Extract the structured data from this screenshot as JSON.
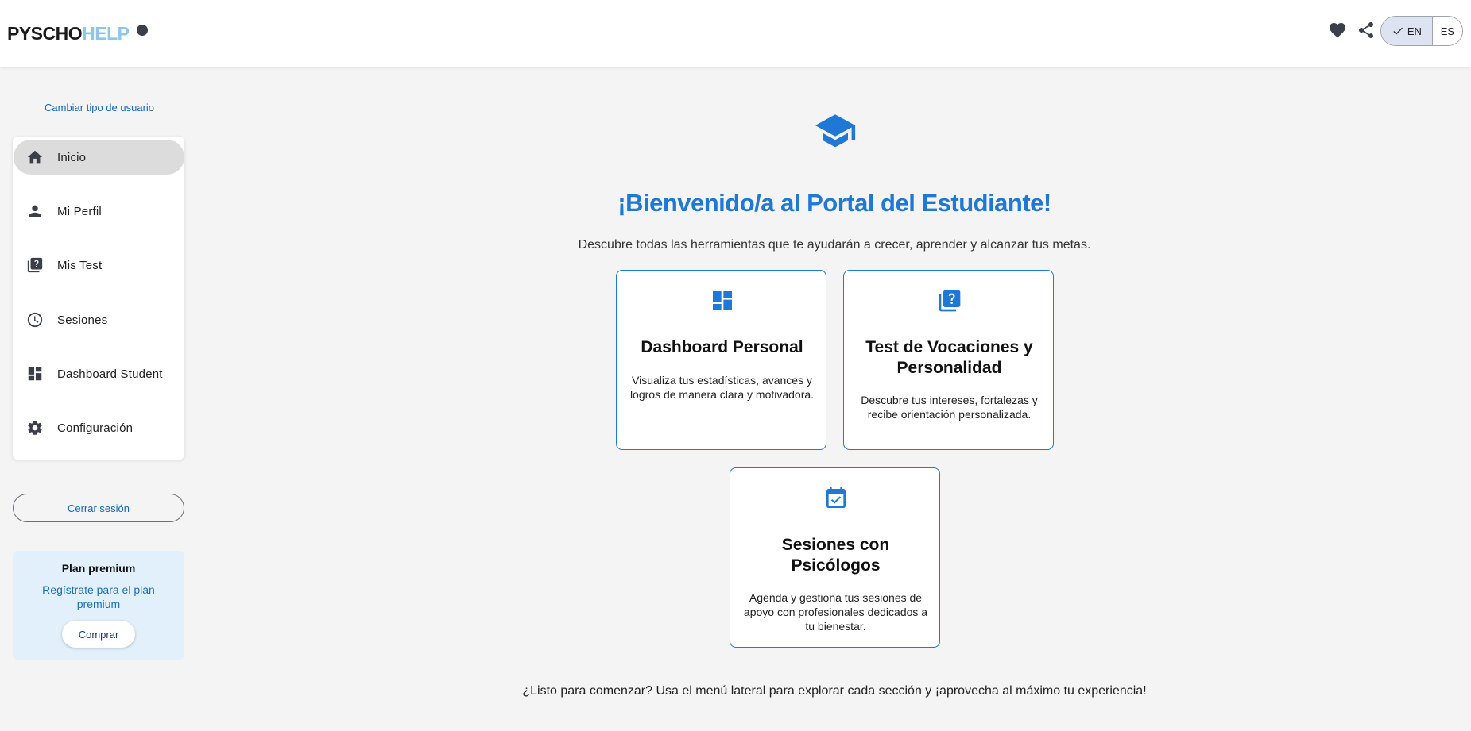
{
  "header": {
    "logo_part1": "PYSCHO",
    "logo_part2": "HELP",
    "lang_en": "EN",
    "lang_es": "ES",
    "selected_lang": "EN"
  },
  "sidebar": {
    "change_user": "Cambiar tipo de usuario",
    "items": [
      {
        "label": "Inicio",
        "icon": "home-icon",
        "active": true
      },
      {
        "label": "Mi Perfil",
        "icon": "person-icon",
        "active": false
      },
      {
        "label": "Mis Test",
        "icon": "quiz-icon",
        "active": false
      },
      {
        "label": "Sesiones",
        "icon": "clock-icon",
        "active": false
      },
      {
        "label": "Dashboard Student",
        "icon": "dashboard-icon",
        "active": false
      },
      {
        "label": "Configuración",
        "icon": "gear-icon",
        "active": false
      }
    ],
    "logout": "Cerrar sesión",
    "premium": {
      "title": "Plan premium",
      "text": "Regístrate para el plan premium",
      "button": "Comprar"
    }
  },
  "main": {
    "title": "¡Bienvenido/a al Portal del Estudiante!",
    "subtitle": "Descubre todas las herramientas que te ayudarán a crecer, aprender y alcanzar tus metas.",
    "cards": [
      {
        "title": "Dashboard Personal",
        "text": "Visualiza tus estadísticas, avances y logros de manera clara y motivadora.",
        "icon": "dashboard-icon"
      },
      {
        "title": "Test de Vocaciones y Personalidad",
        "text": "Descubre tus intereses, fortalezas y recibe orientación personalizada.",
        "icon": "quiz-icon"
      },
      {
        "title": "Sesiones con Psicólogos",
        "text": "Agenda y gestiona tus sesiones de apoyo con profesionales dedicados a tu bienestar.",
        "icon": "calendar-check-icon"
      }
    ],
    "footer": "¿Listo para comenzar? Usa el menú lateral para explorar cada sección y ¡aprovecha al máximo tu experiencia!"
  },
  "colors": {
    "accent": "#1e78d4",
    "link": "#1565c0",
    "logo_light": "#8ec6ea",
    "background": "#f4f4f4",
    "premium_bg": "#e2f0fc"
  }
}
